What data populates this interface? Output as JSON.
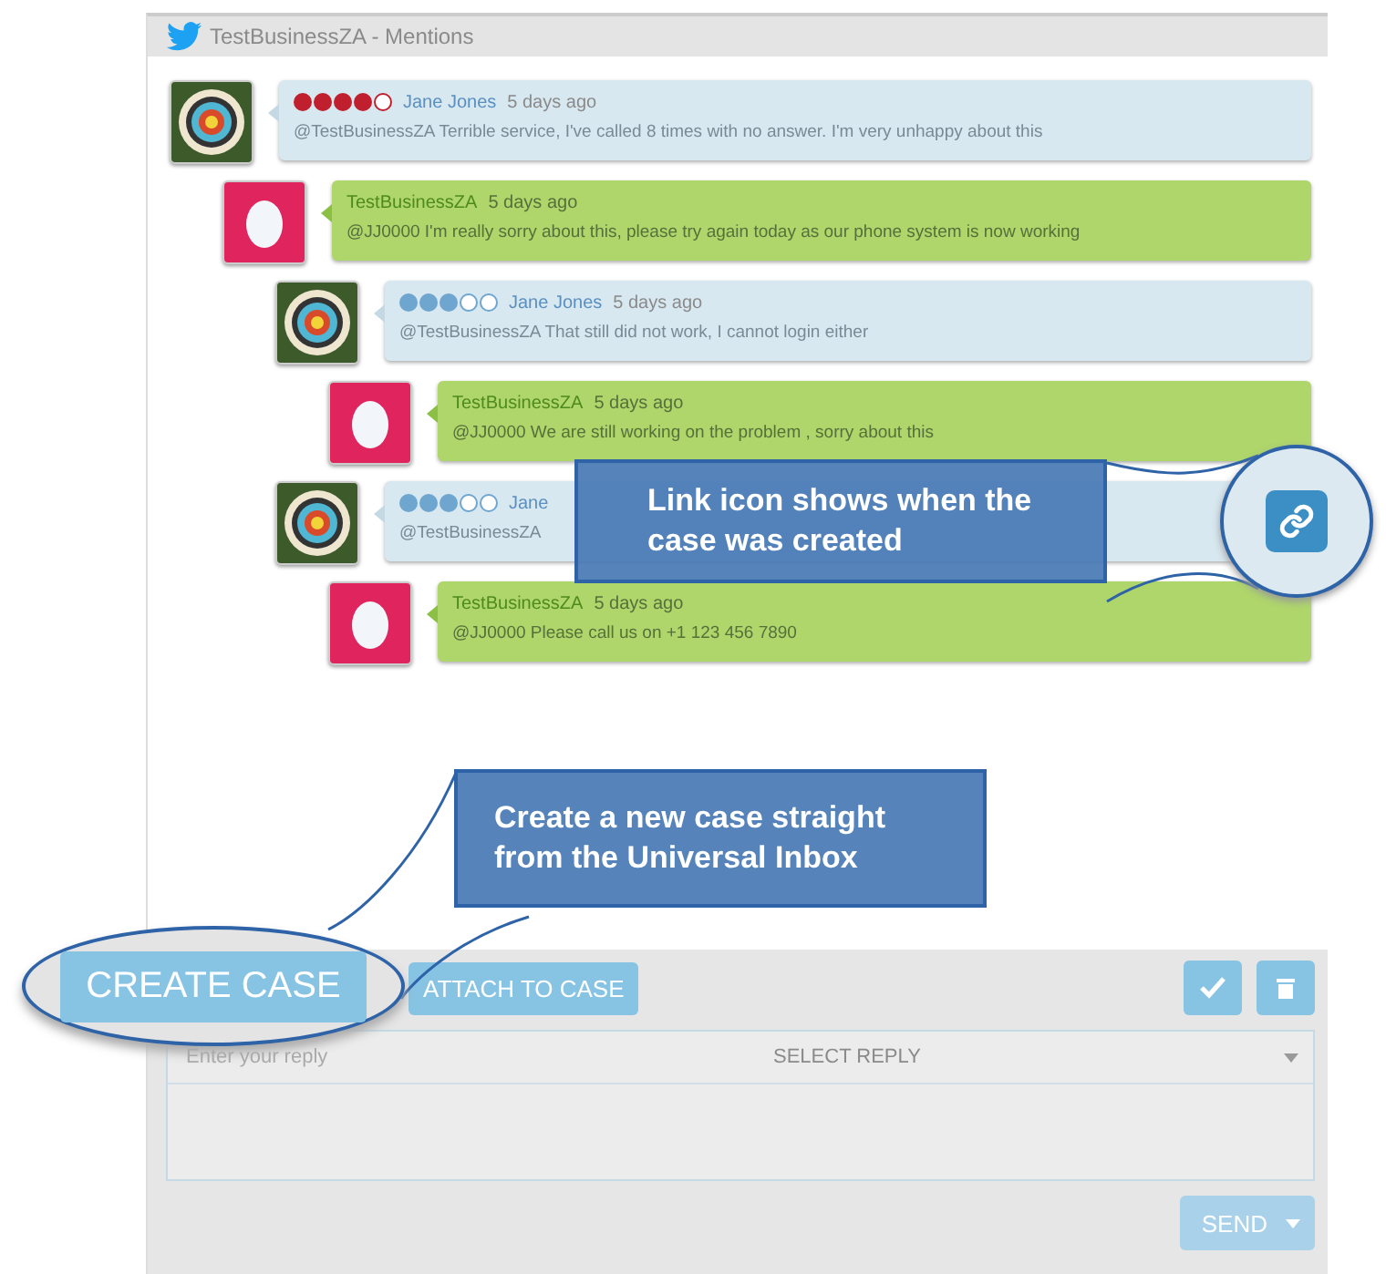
{
  "header": {
    "title": "TestBusinessZA - Mentions"
  },
  "thread": [
    {
      "kind": "customer",
      "author": "Jane Jones",
      "time": "5 days ago",
      "text": "@TestBusinessZA Terrible service, I've called 8 times with no answer. I'm very unhappy about this",
      "stars": 4,
      "color": "#c0202e",
      "children": [
        {
          "kind": "agent",
          "author": "TestBusinessZA",
          "time": "5 days ago",
          "text": "@JJ0000 I'm really sorry about this, please try again today as our phone system is now working",
          "children": [
            {
              "kind": "customer",
              "author": "Jane Jones",
              "time": "5 days ago",
              "text": "@TestBusinessZA That still did not work, I cannot login either",
              "stars": 3,
              "color": "#6fa6cf",
              "children": [
                {
                  "kind": "agent",
                  "author": "TestBusinessZA",
                  "time": "5 days ago",
                  "text": "@JJ0000 We are still working on the problem , sorry about this"
                }
              ]
            },
            {
              "kind": "customer",
              "author": "Jane",
              "text": "@TestBusinessZA",
              "stars": 3,
              "color": "#6fa6cf",
              "children": [
                {
                  "kind": "agent",
                  "author": "TestBusinessZA",
                  "time": "5 days ago",
                  "text": "@JJ0000 Please call us on +1 123 456 7890"
                }
              ]
            }
          ]
        }
      ]
    }
  ],
  "callouts": [
    {
      "kind": "link",
      "text": "Link icon shows when the case was created"
    },
    {
      "kind": "create",
      "text": "Create a new case straight from the Universal Inbox"
    }
  ],
  "actions": {
    "create_case": "CREATE CASE",
    "attach_to_case": "ATTACH TO CASE"
  },
  "reply": {
    "placeholder": "Enter your reply",
    "select": "SELECT REPLY",
    "send": "SEND"
  }
}
